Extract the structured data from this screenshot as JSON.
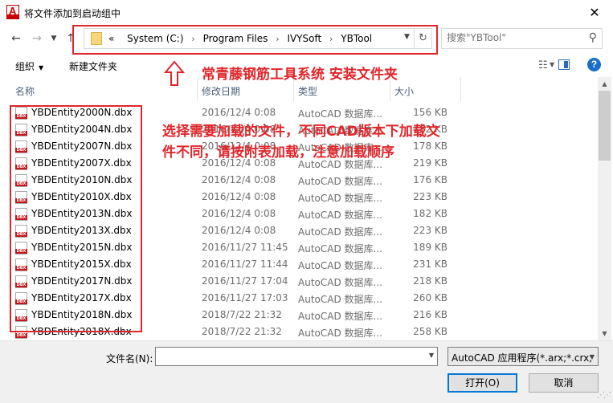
{
  "window": {
    "title": "将文件添加到启动组中",
    "app_icon_letter": "A",
    "close_glyph": "✕"
  },
  "address": {
    "crumb_prefix": "«",
    "crumbs": [
      "System (C:)",
      "Program Files",
      "IVYSoft",
      "YBTool"
    ],
    "separator": "›"
  },
  "search": {
    "placeholder": "搜索\"YBTool\""
  },
  "toolbar": {
    "organize_label": "组织",
    "new_folder_label": "新建文件夹",
    "help_glyph": "?"
  },
  "columns": {
    "name": "名称",
    "date": "修改日期",
    "type": "类型",
    "size": "大小"
  },
  "files": [
    {
      "name": "YBDEntity2000N.dbx",
      "date": "2016/12/4 0:08",
      "type": "AutoCAD 数据库...",
      "size": "156 KB"
    },
    {
      "name": "YBDEntity2004N.dbx",
      "date": "2016/12/4 0:08",
      "type": "AutoCAD 数据库...",
      "size": "182 KB"
    },
    {
      "name": "YBDEntity2007N.dbx",
      "date": "2016/12/4 0:08",
      "type": "AutoCAD 数据库...",
      "size": "178 KB"
    },
    {
      "name": "YBDEntity2007X.dbx",
      "date": "2016/12/4 0:08",
      "type": "AutoCAD 数据库...",
      "size": "219 KB"
    },
    {
      "name": "YBDEntity2010N.dbx",
      "date": "2016/12/4 0:08",
      "type": "AutoCAD 数据库...",
      "size": "176 KB"
    },
    {
      "name": "YBDEntity2010X.dbx",
      "date": "2016/12/4 0:08",
      "type": "AutoCAD 数据库...",
      "size": "223 KB"
    },
    {
      "name": "YBDEntity2013N.dbx",
      "date": "2016/12/4 0:08",
      "type": "AutoCAD 数据库...",
      "size": "182 KB"
    },
    {
      "name": "YBDEntity2013X.dbx",
      "date": "2016/12/4 0:08",
      "type": "AutoCAD 数据库...",
      "size": "223 KB"
    },
    {
      "name": "YBDEntity2015N.dbx",
      "date": "2016/11/27 11:45",
      "type": "AutoCAD 数据库...",
      "size": "189 KB"
    },
    {
      "name": "YBDEntity2015X.dbx",
      "date": "2016/11/27 11:44",
      "type": "AutoCAD 数据库...",
      "size": "231 KB"
    },
    {
      "name": "YBDEntity2017N.dbx",
      "date": "2016/11/27 17:04",
      "type": "AutoCAD 数据库...",
      "size": "218 KB"
    },
    {
      "name": "YBDEntity2017X.dbx",
      "date": "2016/11/27 17:03",
      "type": "AutoCAD 数据库...",
      "size": "260 KB"
    },
    {
      "name": "YBDEntity2018N.dbx",
      "date": "2018/7/22 21:32",
      "type": "AutoCAD 数据库...",
      "size": "216 KB"
    },
    {
      "name": "YBDEntity2018X.dbx",
      "date": "2018/7/22 21:32",
      "type": "AutoCAD 数据库...",
      "size": "258 KB"
    }
  ],
  "bottom": {
    "filename_label": "文件名(N):",
    "filename_value": "",
    "filetype_value": "AutoCAD 应用程序(*.arx;*.crx;",
    "open_label": "打开(O)",
    "cancel_label": "取消"
  },
  "annotations": {
    "top_note": "常青藤钢筋工具系统  安装文件夹",
    "list_note_line1": "选择需要加载的文件，不同CAD版本下加载文",
    "list_note_line2": "件不同，请按附表加载，注意加载顺序",
    "color": "#e0262b"
  },
  "icons": {
    "back": "arrow-left-icon",
    "forward": "arrow-right-icon",
    "up": "arrow-up-icon",
    "refresh": "refresh-icon",
    "search": "magnifier-icon",
    "file": "dbx-file-icon",
    "folder": "folder-icon"
  }
}
